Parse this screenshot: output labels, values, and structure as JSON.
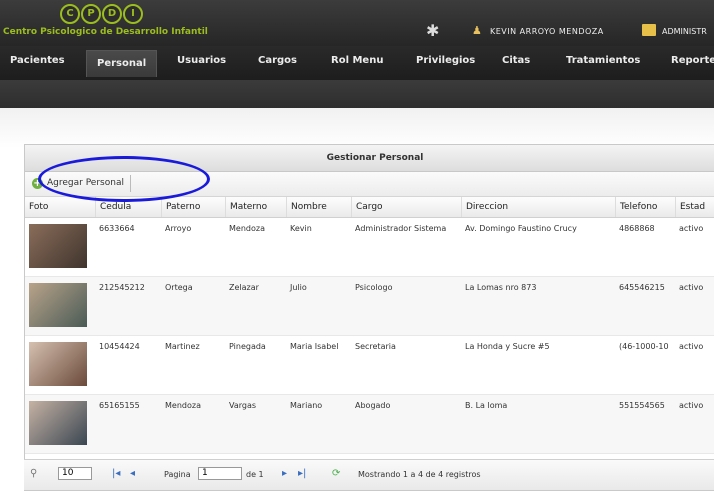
{
  "header": {
    "logo_letters": [
      "C",
      "P",
      "D",
      "I"
    ],
    "brand": "Centro Psicologico de Desarrollo Infantil",
    "user_name": "KEVIN ARROYO MENDOZA",
    "admin_label": "ADMINISTR"
  },
  "menu": [
    "Pacientes",
    "Personal",
    "Usuarios",
    "Cargos",
    "Rol Menu",
    "Privilegios",
    "Citas",
    "Tratamientos",
    "Reporte"
  ],
  "panel": {
    "title": "Gestionar Personal",
    "add_button": "Agregar Personal"
  },
  "table": {
    "columns": [
      "Foto",
      "Cedula",
      "Paterno",
      "Materno",
      "Nombre",
      "Cargo",
      "Direccion",
      "Telefono",
      "Estad"
    ],
    "rows": [
      {
        "cedula": "6633664",
        "paterno": "Arroyo",
        "materno": "Mendoza",
        "nombre": "Kevin",
        "cargo": "Administrador Sistema",
        "direccion": "Av. Domingo Faustino Crucy",
        "telefono": "4868868",
        "estado": "activo"
      },
      {
        "cedula": "212545212",
        "paterno": "Ortega",
        "materno": "Zelazar",
        "nombre": "Julio",
        "cargo": "Psicologo",
        "direccion": "La Lomas nro 873",
        "telefono": "645546215",
        "estado": "activo"
      },
      {
        "cedula": "10454424",
        "paterno": "Martinez",
        "materno": "Pinegada",
        "nombre": "Maria Isabel",
        "cargo": "Secretaria",
        "direccion": "La Honda y Sucre #5",
        "telefono": "(46-1000-10",
        "estado": "activo"
      },
      {
        "cedula": "65165155",
        "paterno": "Mendoza",
        "materno": "Vargas",
        "nombre": "Mariano",
        "cargo": "Abogado",
        "direccion": "B. La loma",
        "telefono": "551554565",
        "estado": "activo"
      }
    ]
  },
  "pager": {
    "page_size": "10",
    "page_label": "Pagina",
    "page_value": "1",
    "of_label": "de 1",
    "records": "Mostrando 1 a 4 de 4 registros"
  }
}
